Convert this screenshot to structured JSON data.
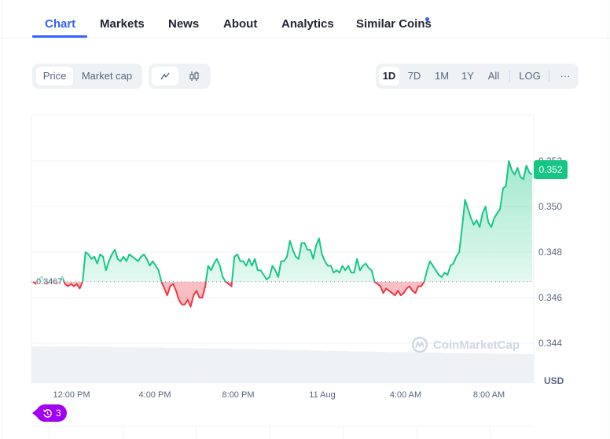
{
  "tabs": [
    {
      "label": "Chart",
      "active": true
    },
    {
      "label": "Markets",
      "active": false
    },
    {
      "label": "News",
      "active": false
    },
    {
      "label": "About",
      "active": false
    },
    {
      "label": "Analytics",
      "active": false
    },
    {
      "label": "Similar Coins",
      "active": false,
      "has_dot": true
    }
  ],
  "controls": {
    "metric_toggle": [
      "Price",
      "Market cap"
    ],
    "metric_selected": "Price",
    "chart_type": [
      {
        "icon": "line-chart-icon"
      },
      {
        "icon": "candlestick-icon"
      }
    ],
    "ranges": [
      "1D",
      "7D",
      "1M",
      "1Y",
      "All"
    ],
    "range_selected": "1D",
    "log_label": "LOG",
    "more_label": "···"
  },
  "colors": {
    "accent": "#3861fb",
    "up": "#16c784",
    "down": "#ea3943",
    "events": "#a100f2"
  },
  "watermark": "CoinMarketCap",
  "events_badge": {
    "count": "3"
  },
  "chart_data": {
    "type": "area",
    "title": "",
    "xlabel": "",
    "ylabel": "USD",
    "currency_label": "USD",
    "baseline": 0.3467,
    "baseline_label": "0.3467",
    "current_price_label": "0.352",
    "ylim": [
      0.3428,
      0.3535
    ],
    "yticks": [
      0.352,
      0.35,
      0.348,
      0.346,
      0.344
    ],
    "ytick_labels": [
      "0.352",
      "0.350",
      "0.348",
      "0.346",
      "0.344"
    ],
    "xticks": [
      "12:00 PM",
      "4:00 PM",
      "8:00 PM",
      "11 Aug",
      "4:00 AM",
      "8:00 AM"
    ],
    "xtick_hours": [
      2,
      6,
      10,
      14,
      18,
      22
    ],
    "x_range_hours": [
      0,
      24.3
    ],
    "series": [
      {
        "name": "Price",
        "values": [
          0.3467,
          0.3466,
          0.3468,
          0.3469,
          0.3467,
          0.3466,
          0.3468,
          0.3467,
          0.3466,
          0.3467,
          0.3469,
          0.3466,
          0.3465,
          0.3466,
          0.3465,
          0.3466,
          0.3464,
          0.3467,
          0.348,
          0.3479,
          0.3477,
          0.3478,
          0.3475,
          0.3479,
          0.3478,
          0.3472,
          0.3476,
          0.3479,
          0.3481,
          0.3477,
          0.3476,
          0.3478,
          0.3476,
          0.3479,
          0.3478,
          0.3477,
          0.3476,
          0.3478,
          0.3479,
          0.3477,
          0.3474,
          0.3476,
          0.3474,
          0.3472,
          0.3467,
          0.3464,
          0.3461,
          0.3465,
          0.3466,
          0.3463,
          0.3459,
          0.3457,
          0.3457,
          0.3459,
          0.3456,
          0.3461,
          0.3463,
          0.346,
          0.346,
          0.3465,
          0.3474,
          0.3472,
          0.3475,
          0.3477,
          0.3474,
          0.3469,
          0.3467,
          0.3466,
          0.3465,
          0.3478,
          0.3479,
          0.3476,
          0.3476,
          0.3474,
          0.3477,
          0.3474,
          0.3477,
          0.3472,
          0.3472,
          0.347,
          0.3468,
          0.3469,
          0.3474,
          0.3472,
          0.3469,
          0.3476,
          0.3476,
          0.3478,
          0.3485,
          0.3481,
          0.3478,
          0.3477,
          0.3484,
          0.3484,
          0.3481,
          0.3481,
          0.3477,
          0.3483,
          0.3486,
          0.3479,
          0.3476,
          0.3474,
          0.3474,
          0.3471,
          0.3472,
          0.3471,
          0.3474,
          0.3472,
          0.3474,
          0.3471,
          0.3471,
          0.3477,
          0.3472,
          0.3474,
          0.3475,
          0.3473,
          0.3472,
          0.3467,
          0.3466,
          0.3465,
          0.3462,
          0.3464,
          0.3463,
          0.3462,
          0.3461,
          0.3463,
          0.3461,
          0.3462,
          0.3464,
          0.3465,
          0.3463,
          0.3462,
          0.3465,
          0.3465,
          0.3467,
          0.3472,
          0.3476,
          0.3474,
          0.3472,
          0.347,
          0.3469,
          0.3471,
          0.347,
          0.3474,
          0.3475,
          0.3478,
          0.348,
          0.3491,
          0.3503,
          0.3499,
          0.3495,
          0.3492,
          0.3494,
          0.3491,
          0.3497,
          0.35,
          0.3493,
          0.3491,
          0.3495,
          0.3497,
          0.3499,
          0.3508,
          0.3509,
          0.352,
          0.3516,
          0.3514,
          0.3517,
          0.3513,
          0.3512,
          0.3518,
          0.3515,
          0.3514
        ]
      }
    ],
    "volume_series": {
      "name": "Volume (relative)",
      "values": [
        1.0,
        0.99,
        1.0,
        1.0,
        0.99,
        0.99,
        0.98,
        0.98,
        0.97,
        0.97,
        0.96,
        0.96,
        0.95,
        0.94,
        0.94,
        0.93,
        0.93,
        0.92,
        0.91,
        0.9,
        0.9,
        0.89,
        0.88,
        0.87,
        0.86,
        0.86,
        0.85,
        0.84,
        0.84,
        0.83,
        0.83,
        0.82,
        0.82,
        0.81,
        0.81,
        0.8,
        0.8,
        0.79
      ]
    }
  }
}
